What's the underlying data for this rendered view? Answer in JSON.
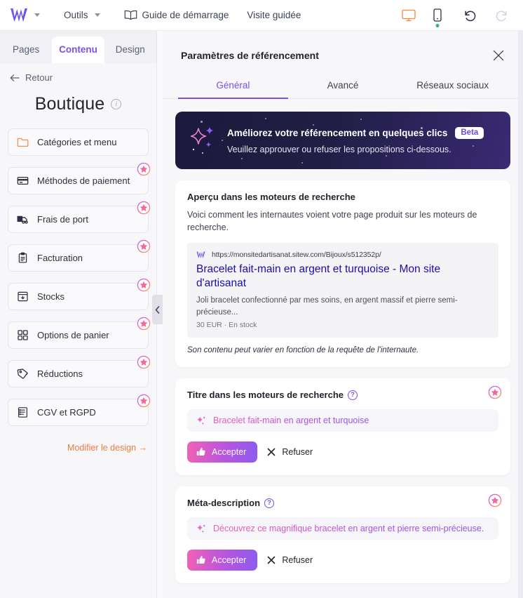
{
  "topbar": {
    "logo": "sitew-w-logo",
    "logo_caret": "chevron-down-icon",
    "outils": "Outils",
    "guide": "Guide de démarrage",
    "visite": "Visite guidée",
    "desktop_icon": "desktop-preview-icon",
    "mobile_icon": "mobile-preview-icon",
    "undo_icon": "undo-icon",
    "redo_icon": "redo-icon"
  },
  "sidebar": {
    "tabs": [
      {
        "label": "Pages",
        "active": false
      },
      {
        "label": "Contenu",
        "active": true
      },
      {
        "label": "Design",
        "active": false
      }
    ],
    "back_label": "Retour",
    "title": "Boutique",
    "items": [
      {
        "label": "Catégories et menu",
        "icon": "folder-icon",
        "premium": false
      },
      {
        "label": "Méthodes de paiement",
        "icon": "credit-card-icon",
        "premium": true
      },
      {
        "label": "Frais de port",
        "icon": "truck-icon",
        "premium": true
      },
      {
        "label": "Facturation",
        "icon": "clipboard-icon",
        "premium": true
      },
      {
        "label": "Stocks",
        "icon": "inventory-icon",
        "premium": true
      },
      {
        "label": "Options de panier",
        "icon": "grid-icon",
        "premium": true
      },
      {
        "label": "Réductions",
        "icon": "tag-icon",
        "premium": true
      },
      {
        "label": "CGV et RGPD",
        "icon": "document-list-icon",
        "premium": true
      }
    ],
    "design_link": "Modifier le design →"
  },
  "panel": {
    "title": "Paramètres de référencement",
    "close_icon": "close-icon",
    "tabs": [
      {
        "label": "Général",
        "active": true
      },
      {
        "label": "Avancé",
        "active": false
      },
      {
        "label": "Réseaux sociaux",
        "active": false
      }
    ],
    "promo": {
      "title": "Améliorez votre référencement en quelques clics",
      "badge": "Beta",
      "subtitle": "Veuillez approuver ou refuser les propositions ci-dessous.",
      "icon": "sparkles-icon"
    },
    "preview_card": {
      "title": "Aperçu dans les moteurs de recherche",
      "description": "Voici comment les internautes voient votre page produit sur les moteurs de recherche.",
      "serp": {
        "favicon": "sitew-w-favicon",
        "url": "https://monsitedartisanat.sitew.com/Bijoux/s512352p/",
        "title": "Bracelet fait-main en argent et turquoise - Mon site d'artisanat",
        "description": "Joli bracelet confectionné par mes soins, en argent massif et pierre semi-précieuse...",
        "meta": "30 EUR · En stock"
      },
      "note": "Son contenu peut varier en fonction de la requête de l'internaute."
    },
    "title_card": {
      "title": "Titre dans les moteurs de recherche",
      "help_icon": "help-circle-icon",
      "premium_icon": "premium-star-icon",
      "suggestion_icon": "ai-sparkle-icon",
      "suggestion": "Bracelet fait-main en argent et turquoise",
      "accept_label": "Accepter",
      "accept_icon": "thumbs-up-icon",
      "refuse_label": "Refuser",
      "refuse_icon": "x-icon"
    },
    "meta_card": {
      "title": "Méta-description",
      "help_icon": "help-circle-icon",
      "premium_icon": "premium-star-icon",
      "suggestion_icon": "ai-sparkle-icon",
      "suggestion": "Découvrez ce magnifique bracelet en argent et pierre semi-précieuse.",
      "accept_label": "Accepter",
      "accept_icon": "thumbs-up-icon",
      "refuse_label": "Refuser",
      "refuse_icon": "x-icon"
    }
  },
  "collapse_handle_icon": "chevron-left-icon",
  "colors": {
    "accent_purple": "#7b4fe8",
    "orange": "#f27a3c",
    "pink": "#f162b4",
    "link_blue": "#1a0dab",
    "banner_dark": "#1b1a3c",
    "online_green": "#2eb87a"
  }
}
